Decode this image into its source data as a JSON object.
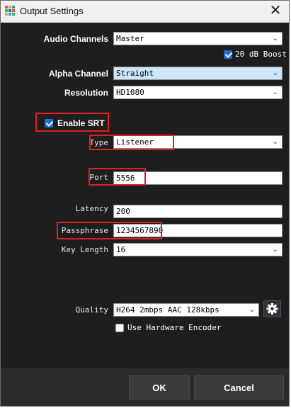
{
  "window": {
    "title": "Output Settings",
    "close_glyph": "✕"
  },
  "audio": {
    "label": "Audio Channels",
    "value": "Master",
    "boost_label": "20 dB Boost",
    "boost_checked": true
  },
  "alpha": {
    "label": "Alpha Channel",
    "value": "Straight"
  },
  "resolution": {
    "label": "Resolution",
    "value": "HD1080"
  },
  "srt": {
    "label": "Enable SRT",
    "checked": true
  },
  "type": {
    "label": "Type",
    "value": "Listener"
  },
  "port": {
    "label": "Port",
    "value": "5556"
  },
  "latency": {
    "label": "Latency",
    "value": "200"
  },
  "passphrase": {
    "label": "Passphrase",
    "value": "1234567890"
  },
  "key_length": {
    "label": "Key Length",
    "value": "16"
  },
  "quality": {
    "label": "Quality",
    "value": "H264 2mbps AAC 128kbps",
    "settings_icon": "gear-icon"
  },
  "hardware": {
    "label": "Use Hardware Encoder",
    "checked": false
  },
  "buttons": {
    "ok": "OK",
    "cancel": "Cancel"
  },
  "colors": {
    "annotation": "#e02020",
    "accent": "#1e6fd1",
    "background": "#1e1e1e"
  }
}
